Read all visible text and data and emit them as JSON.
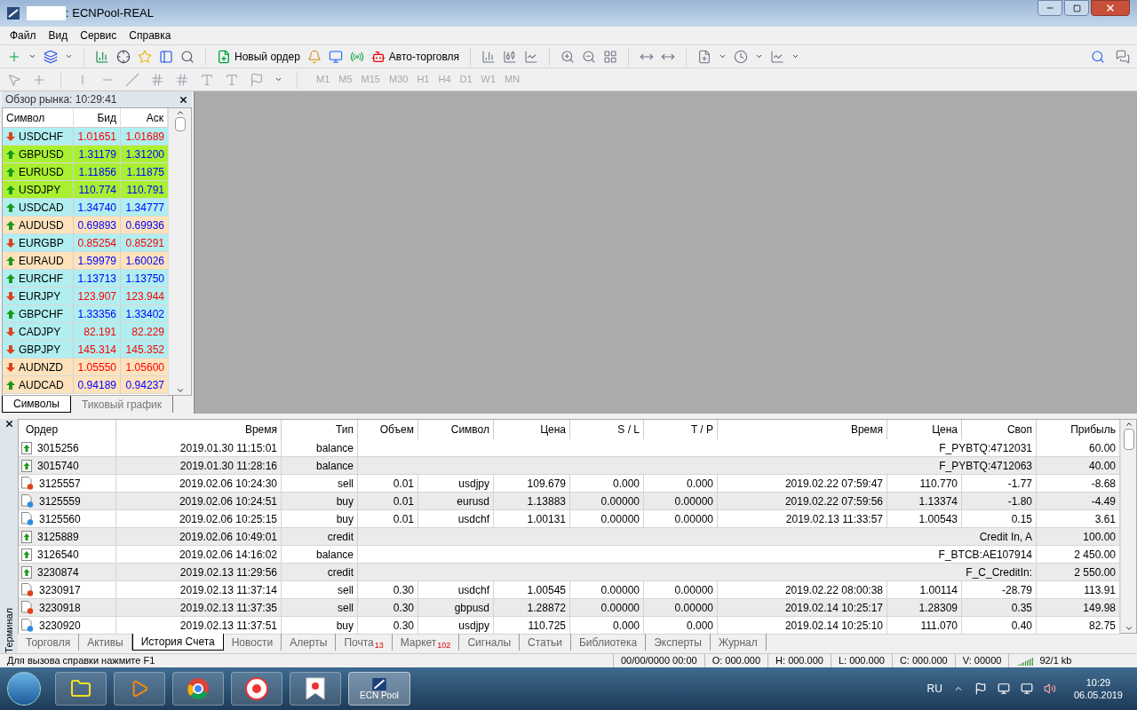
{
  "window": {
    "title": ": ECNPool-REAL"
  },
  "menu": [
    "Файл",
    "Вид",
    "Сервис",
    "Справка"
  ],
  "toolbar": {
    "new_order": "Новый ордер",
    "auto_trading": "Авто-торговля"
  },
  "timeframes": [
    {
      "label": "M1",
      "disabled": true
    },
    {
      "label": "M5",
      "disabled": true
    },
    {
      "label": "M15",
      "disabled": true
    },
    {
      "label": "M30",
      "disabled": true
    },
    {
      "label": "H1",
      "disabled": true
    },
    {
      "label": "H4",
      "disabled": true
    },
    {
      "label": "D1",
      "disabled": true
    },
    {
      "label": "W1",
      "disabled": true
    },
    {
      "label": "MN",
      "disabled": true
    }
  ],
  "market_watch": {
    "title": "Обзор рынка: 10:29:41",
    "columns": [
      "Символ",
      "Бид",
      "Аск"
    ],
    "rows": [
      {
        "symbol": "USDCHF",
        "bid": "1.01651",
        "ask": "1.01689",
        "kind": "down",
        "color": "#b0eef0"
      },
      {
        "symbol": "GBPUSD",
        "bid": "1.31179",
        "ask": "1.31200",
        "kind": "up",
        "color": "#a8f030"
      },
      {
        "symbol": "EURUSD",
        "bid": "1.11856",
        "ask": "1.11875",
        "kind": "up",
        "color": "#a8f030"
      },
      {
        "symbol": "USDJPY",
        "bid": "110.774",
        "ask": "110.791",
        "kind": "up",
        "color": "#a8f030"
      },
      {
        "symbol": "USDCAD",
        "bid": "1.34740",
        "ask": "1.34777",
        "kind": "up",
        "color": "#b0eef0"
      },
      {
        "symbol": "AUDUSD",
        "bid": "0.69893",
        "ask": "0.69936",
        "kind": "up",
        "color": "#fde2bc"
      },
      {
        "symbol": "EURGBP",
        "bid": "0.85254",
        "ask": "0.85291",
        "kind": "down",
        "color": "#b0eef0"
      },
      {
        "symbol": "EURAUD",
        "bid": "1.59979",
        "ask": "1.60026",
        "kind": "up",
        "color": "#fde2bc"
      },
      {
        "symbol": "EURCHF",
        "bid": "1.13713",
        "ask": "1.13750",
        "kind": "up",
        "color": "#b0eef0"
      },
      {
        "symbol": "EURJPY",
        "bid": "123.907",
        "ask": "123.944",
        "kind": "down",
        "color": "#b0eef0"
      },
      {
        "symbol": "GBPCHF",
        "bid": "1.33356",
        "ask": "1.33402",
        "kind": "up",
        "color": "#b0eef0"
      },
      {
        "symbol": "CADJPY",
        "bid": "82.191",
        "ask": "82.229",
        "kind": "down",
        "color": "#b0eef0"
      },
      {
        "symbol": "GBPJPY",
        "bid": "145.314",
        "ask": "145.352",
        "kind": "down",
        "color": "#b0eef0"
      },
      {
        "symbol": "AUDNZD",
        "bid": "1.05550",
        "ask": "1.05600",
        "kind": "down",
        "color": "#fde2bc"
      },
      {
        "symbol": "AUDCAD",
        "bid": "0.94189",
        "ask": "0.94237",
        "kind": "up",
        "color": "#fde2bc"
      }
    ],
    "tabs": [
      {
        "label": "Символы",
        "selected": true
      },
      {
        "label": "Тиковый график",
        "selected": false
      }
    ]
  },
  "terminal": {
    "side_label": "Терминал",
    "columns": [
      "Ордер",
      "Время",
      "Тип",
      "Объем",
      "Символ",
      "Цена",
      "S / L",
      "T / P",
      "Время",
      "Цена",
      "Своп",
      "Прибыль"
    ],
    "rows": [
      {
        "kind": "deposit",
        "order": "3015256",
        "open_time": "2019.01.30 11:15:01",
        "type": "balance",
        "comment": "F_PYBTQ:4712031",
        "profit": "60.00"
      },
      {
        "kind": "deposit",
        "order": "3015740",
        "open_time": "2019.01.30 11:28:16",
        "type": "balance",
        "comment": "F_PYBTQ:4712063",
        "profit": "40.00"
      },
      {
        "kind": "sell",
        "order": "3125557",
        "open_time": "2019.02.06 10:24:30",
        "type": "sell",
        "volume": "0.01",
        "symbol": "usdjpy",
        "open_price": "109.679",
        "sl": "0.000",
        "tp": "0.000",
        "close_time": "2019.02.22 07:59:47",
        "close_price": "110.770",
        "swap": "-1.77",
        "profit": "-8.68"
      },
      {
        "kind": "buy",
        "order": "3125559",
        "open_time": "2019.02.06 10:24:51",
        "type": "buy",
        "volume": "0.01",
        "symbol": "eurusd",
        "open_price": "1.13883",
        "sl": "0.00000",
        "tp": "0.00000",
        "close_time": "2019.02.22 07:59:56",
        "close_price": "1.13374",
        "swap": "-1.80",
        "profit": "-4.49"
      },
      {
        "kind": "buy",
        "order": "3125560",
        "open_time": "2019.02.06 10:25:15",
        "type": "buy",
        "volume": "0.01",
        "symbol": "usdchf",
        "open_price": "1.00131",
        "sl": "0.00000",
        "tp": "0.00000",
        "close_time": "2019.02.13 11:33:57",
        "close_price": "1.00543",
        "swap": "0.15",
        "profit": "3.61"
      },
      {
        "kind": "deposit",
        "order": "3125889",
        "open_time": "2019.02.06 10:49:01",
        "type": "credit",
        "comment": "Credit In, A",
        "profit": "100.00"
      },
      {
        "kind": "deposit",
        "order": "3126540",
        "open_time": "2019.02.06 14:16:02",
        "type": "balance",
        "comment": "F_BTCB:AE107914",
        "profit": "2 450.00"
      },
      {
        "kind": "deposit",
        "order": "3230874",
        "open_time": "2019.02.13 11:29:56",
        "type": "credit",
        "comment": "F_C_CreditIn:",
        "profit": "2 550.00"
      },
      {
        "kind": "sell",
        "order": "3230917",
        "open_time": "2019.02.13 11:37:14",
        "type": "sell",
        "volume": "0.30",
        "symbol": "usdchf",
        "open_price": "1.00545",
        "sl": "0.00000",
        "tp": "0.00000",
        "close_time": "2019.02.22 08:00:38",
        "close_price": "1.00114",
        "swap": "-28.79",
        "profit": "113.91"
      },
      {
        "kind": "sell",
        "order": "3230918",
        "open_time": "2019.02.13 11:37:35",
        "type": "sell",
        "volume": "0.30",
        "symbol": "gbpusd",
        "open_price": "1.28872",
        "sl": "0.00000",
        "tp": "0.00000",
        "close_time": "2019.02.14 10:25:17",
        "close_price": "1.28309",
        "swap": "0.35",
        "profit": "149.98"
      },
      {
        "kind": "buy",
        "order": "3230920",
        "open_time": "2019.02.13 11:37:51",
        "type": "buy",
        "volume": "0.30",
        "symbol": "usdjpy",
        "open_price": "110.725",
        "sl": "0.000",
        "tp": "0.000",
        "close_time": "2019.02.14 10:25:10",
        "close_price": "111.070",
        "swap": "0.40",
        "profit": "82.75"
      }
    ],
    "tabs": [
      {
        "label": "Торговля",
        "selected": false
      },
      {
        "label": "Активы",
        "selected": false
      },
      {
        "label": "История Счета",
        "selected": true
      },
      {
        "label": "Новости",
        "selected": false
      },
      {
        "label": "Алерты",
        "selected": false
      },
      {
        "label": "Почта",
        "count": "13",
        "selected": false
      },
      {
        "label": "Маркет",
        "count": "102",
        "selected": false
      },
      {
        "label": "Сигналы",
        "selected": false
      },
      {
        "label": "Статьи",
        "selected": false
      },
      {
        "label": "Библиотека",
        "selected": false
      },
      {
        "label": "Эксперты",
        "selected": false
      },
      {
        "label": "Журнал",
        "selected": false
      }
    ]
  },
  "status_bar": {
    "hint": "Для вызова справки нажмите F1",
    "date": "00/00/0000 00:00",
    "open": "O: 000.000",
    "high": "H: 000.000",
    "low": "L: 000.000",
    "close": "C: 000.000",
    "volume": "V: 00000",
    "traffic": "92/1 kb"
  },
  "taskbar": {
    "app_label": "ECN Pool",
    "language": "RU",
    "time": "10:29",
    "date": "06.05.2019"
  }
}
